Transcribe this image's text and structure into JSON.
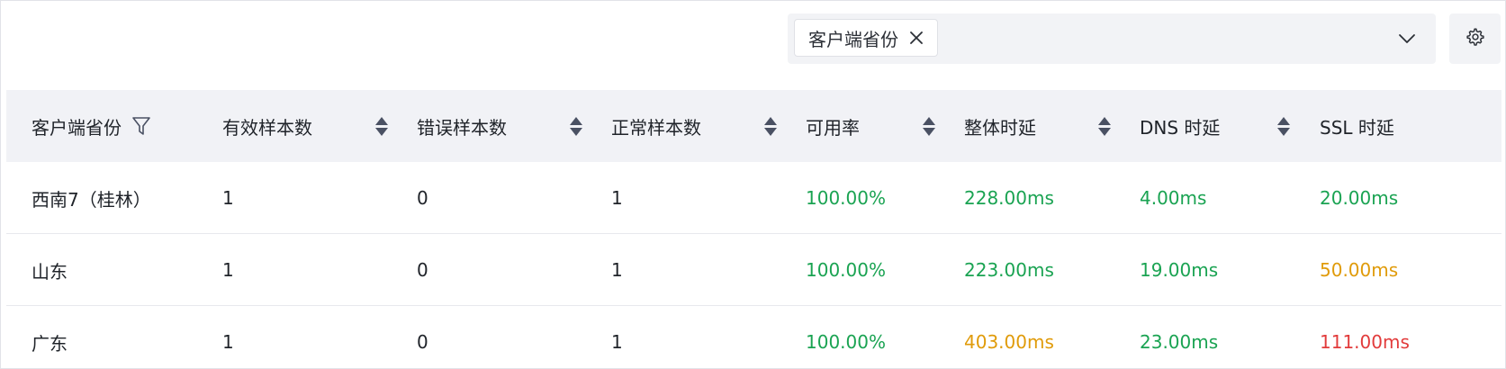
{
  "filter": {
    "tag_label": "客户端省份",
    "close_icon": "close-icon",
    "dropdown_icon": "chevron-down-icon"
  },
  "settings": {
    "icon": "gear-icon"
  },
  "colors": {
    "good": "#1aa352",
    "warn": "#e09b0a",
    "bad": "#e23b3b",
    "header_bg": "#f1f2f6",
    "sorter": "#4a5163"
  },
  "table": {
    "columns": [
      {
        "label": "客户端省份",
        "icon": "filter-icon"
      },
      {
        "label": "有效样本数",
        "icon": "sort-icon"
      },
      {
        "label": "错误样本数",
        "icon": "sort-icon"
      },
      {
        "label": "正常样本数",
        "icon": "sort-icon"
      },
      {
        "label": "可用率",
        "icon": "sort-icon"
      },
      {
        "label": "整体时延",
        "icon": "sort-icon"
      },
      {
        "label": "DNS 时延",
        "icon": "sort-icon"
      },
      {
        "label": "SSL 时延",
        "icon": "sort-icon"
      }
    ],
    "rows": [
      {
        "cells": [
          "西南7（桂林）",
          "1",
          "0",
          "1",
          "100.00%",
          "228.00ms",
          "4.00ms",
          "20.00ms"
        ],
        "status": [
          "",
          "",
          "",
          "",
          "good",
          "good",
          "good",
          "good"
        ]
      },
      {
        "cells": [
          "山东",
          "1",
          "0",
          "1",
          "100.00%",
          "223.00ms",
          "19.00ms",
          "50.00ms"
        ],
        "status": [
          "",
          "",
          "",
          "",
          "good",
          "good",
          "good",
          "warn"
        ]
      },
      {
        "cells": [
          "广东",
          "1",
          "0",
          "1",
          "100.00%",
          "403.00ms",
          "23.00ms",
          "111.00ms"
        ],
        "status": [
          "",
          "",
          "",
          "",
          "good",
          "warn",
          "good",
          "bad"
        ]
      }
    ]
  }
}
